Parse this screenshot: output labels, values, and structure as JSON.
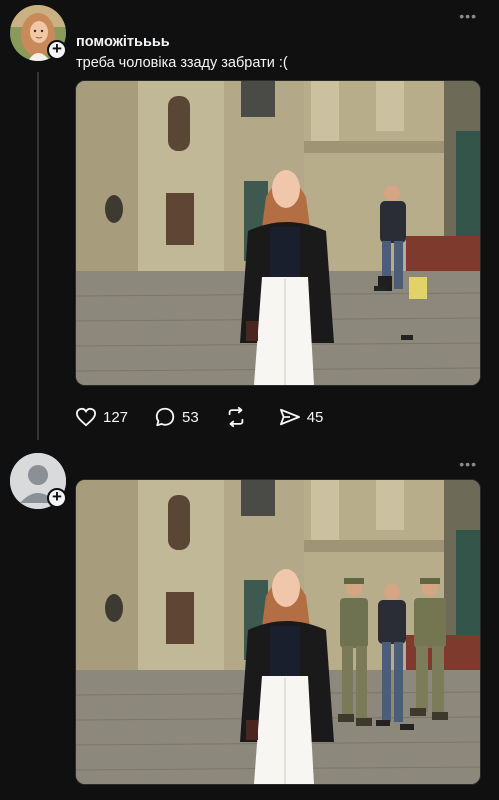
{
  "posts": [
    {
      "username": "поможітьььь",
      "text": "треба чоловіка ззаду забрати :(",
      "more": "•••",
      "stats": {
        "likes": "127",
        "comments": "53",
        "shares": "45"
      }
    },
    {
      "username": "",
      "text": "",
      "more": "•••"
    }
  ],
  "colors": {
    "background": "#101010",
    "text": "#f3f5f7",
    "thread_line": "#333638",
    "muted": "#8a8a8a"
  },
  "icons": [
    "heart-icon",
    "comment-icon",
    "repost-icon",
    "share-icon",
    "plus-icon",
    "more-icon"
  ]
}
